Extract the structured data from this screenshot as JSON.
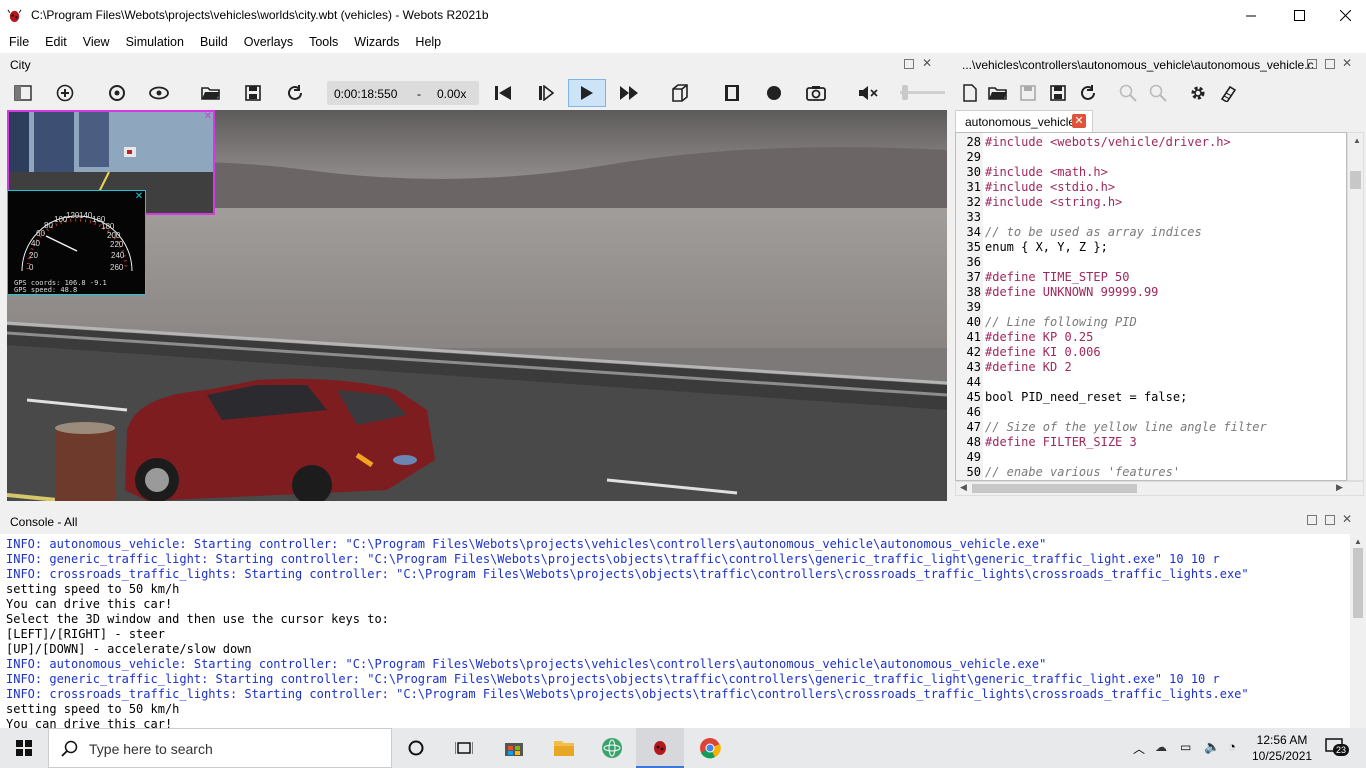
{
  "window": {
    "title": "C:\\Program Files\\Webots\\projects\\vehicles\\worlds\\city.wbt (vehicles) - Webots R2021b"
  },
  "menu": [
    "File",
    "Edit",
    "View",
    "Simulation",
    "Build",
    "Overlays",
    "Tools",
    "Wizards",
    "Help"
  ],
  "scene_panel": {
    "title": "City"
  },
  "editor_panel": {
    "title": "...\\vehicles\\controllers\\autonomous_vehicle\\autonomous_vehicle.c",
    "tab": "autonomous_vehicle.c"
  },
  "toolbar": {
    "time": "0:00:18:550",
    "speed_sep": "-",
    "speed": "0.00x"
  },
  "overlay": {
    "gps_coords": "GPS coords: 106.8 -9.1",
    "gps_speed": "GPS speed: 48.8",
    "speedo_ticks": [
      "0",
      "20",
      "40",
      "60",
      "80",
      "100",
      "120",
      "140",
      "160",
      "180",
      "200",
      "220",
      "240",
      "260"
    ]
  },
  "code": [
    {
      "n": "28",
      "t": "#include <webots/vehicle/driver.h>",
      "k": "pp"
    },
    {
      "n": "29",
      "t": "",
      "k": ""
    },
    {
      "n": "30",
      "t": "#include <math.h>",
      "k": "pp"
    },
    {
      "n": "31",
      "t": "#include <stdio.h>",
      "k": "pp"
    },
    {
      "n": "32",
      "t": "#include <string.h>",
      "k": "pp"
    },
    {
      "n": "33",
      "t": "",
      "k": ""
    },
    {
      "n": "34",
      "t": "// to be used as array indices",
      "k": "cm"
    },
    {
      "n": "35",
      "t": "enum { X, Y, Z };",
      "k": ""
    },
    {
      "n": "36",
      "t": "",
      "k": ""
    },
    {
      "n": "37",
      "t": "#define TIME_STEP 50",
      "k": "pp"
    },
    {
      "n": "38",
      "t": "#define UNKNOWN 99999.99",
      "k": "pp"
    },
    {
      "n": "39",
      "t": "",
      "k": ""
    },
    {
      "n": "40",
      "t": "// Line following PID",
      "k": "cm"
    },
    {
      "n": "41",
      "t": "#define KP 0.25",
      "k": "pp"
    },
    {
      "n": "42",
      "t": "#define KI 0.006",
      "k": "pp"
    },
    {
      "n": "43",
      "t": "#define KD 2",
      "k": "pp"
    },
    {
      "n": "44",
      "t": "",
      "k": ""
    },
    {
      "n": "45",
      "t": "bool PID_need_reset = false;",
      "k": ""
    },
    {
      "n": "46",
      "t": "",
      "k": ""
    },
    {
      "n": "47",
      "t": "// Size of the yellow line angle filter",
      "k": "cm"
    },
    {
      "n": "48",
      "t": "#define FILTER_SIZE 3",
      "k": "pp"
    },
    {
      "n": "49",
      "t": "",
      "k": ""
    },
    {
      "n": "50",
      "t": "// enabe various 'features'",
      "k": "cm"
    }
  ],
  "console": {
    "title": "Console - All",
    "lines": [
      {
        "t": "INFO: autonomous_vehicle: Starting controller: \"C:\\Program Files\\Webots\\projects\\vehicles\\controllers\\autonomous_vehicle\\autonomous_vehicle.exe\"",
        "info": true
      },
      {
        "t": "INFO: generic_traffic_light: Starting controller: \"C:\\Program Files\\Webots\\projects\\objects\\traffic\\controllers\\generic_traffic_light\\generic_traffic_light.exe\" 10 10 r",
        "info": true
      },
      {
        "t": "INFO: crossroads_traffic_lights: Starting controller: \"C:\\Program Files\\Webots\\projects\\objects\\traffic\\controllers\\crossroads_traffic_lights\\crossroads_traffic_lights.exe\"",
        "info": true
      },
      {
        "t": "setting speed to 50 km/h",
        "info": false
      },
      {
        "t": "You can drive this car!",
        "info": false
      },
      {
        "t": "Select the 3D window and then use the cursor keys to:",
        "info": false
      },
      {
        "t": "[LEFT]/[RIGHT] - steer",
        "info": false
      },
      {
        "t": "[UP]/[DOWN] - accelerate/slow down",
        "info": false
      },
      {
        "t": "INFO: autonomous_vehicle: Starting controller: \"C:\\Program Files\\Webots\\projects\\vehicles\\controllers\\autonomous_vehicle\\autonomous_vehicle.exe\"",
        "info": true
      },
      {
        "t": "INFO: generic_traffic_light: Starting controller: \"C:\\Program Files\\Webots\\projects\\objects\\traffic\\controllers\\generic_traffic_light\\generic_traffic_light.exe\" 10 10 r",
        "info": true
      },
      {
        "t": "INFO: crossroads_traffic_lights: Starting controller: \"C:\\Program Files\\Webots\\projects\\objects\\traffic\\controllers\\crossroads_traffic_lights\\crossroads_traffic_lights.exe\"",
        "info": true
      },
      {
        "t": "setting speed to 50 km/h",
        "info": false
      },
      {
        "t": "You can drive this car!",
        "info": false
      }
    ]
  },
  "taskbar": {
    "search_placeholder": "Type here to search",
    "time": "12:56 AM",
    "date": "10/25/2021",
    "notifications": "23"
  }
}
